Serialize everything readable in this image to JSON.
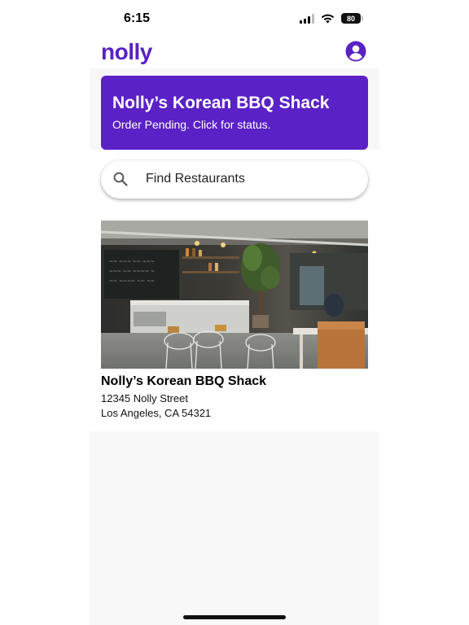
{
  "status_bar": {
    "time": "6:15",
    "battery": "80",
    "icons": [
      "signal-icon",
      "wifi-icon",
      "battery-icon"
    ]
  },
  "header": {
    "brand": "nolly",
    "brand_color": "#5a21c6",
    "profile_icon": "profile-icon"
  },
  "order_banner": {
    "title": "Nolly’s Korean BBQ Shack",
    "status": "Order Pending. Click for status.",
    "background": "#5a21c6"
  },
  "search": {
    "placeholder": "Find Restaurants",
    "icon": "search-icon"
  },
  "restaurants": [
    {
      "name": "Nolly’s Korean BBQ Shack",
      "address_line1": "12345 Nolly Street",
      "address_line2": "Los Angeles, CA 54321"
    }
  ]
}
